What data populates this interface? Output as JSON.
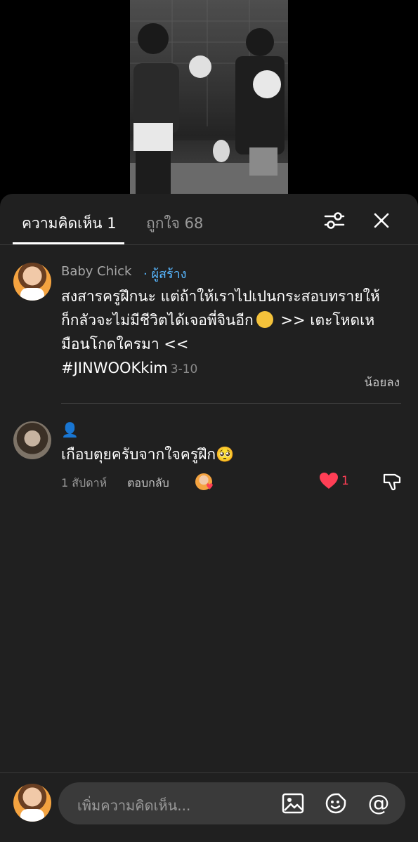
{
  "tabs": {
    "comments": "ความคิดเห็น 1",
    "likes": "ถูกใจ 68"
  },
  "comments": [
    {
      "author": "Baby Chick",
      "creator_tag": "· ผู้สร้าง",
      "text_line1": "สงสารครูฝึกนะ แต่ถ้าให้เราไปเปนกระสอบทรายให้",
      "text_line2a": "ก็กลัวจะไม่มีชีวิตได้เจอพี่จินอีก",
      "emoji": "face-with-tears-of-joy-icon",
      "text_line2b": ">> เตะโหดเห",
      "text_line3": "มือนโกดใครมา <<",
      "hashtag": "#JINWOOKkim",
      "date": "3-10",
      "show_less": "น้อยลง"
    },
    {
      "author": "👤",
      "text": "เกือบตุยครับจากใจครูฝึก🥺",
      "time": "1 สัปดาห์",
      "reply": "ตอบกลับ",
      "likes": "1"
    }
  ],
  "input": {
    "placeholder": "เพิ่มความคิดเห็น...",
    "at_symbol": "@"
  },
  "colors": {
    "accent_blue": "#58b7ff",
    "like_red": "#ff3e55",
    "sheet_bg": "#202020"
  }
}
